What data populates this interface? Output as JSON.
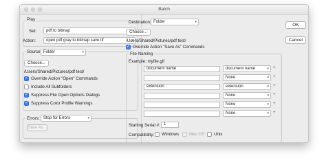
{
  "window": {
    "title": "Batch"
  },
  "play": {
    "group_label": "Play",
    "set_label": "Set:",
    "set_value": "pdf to bitmap",
    "action_label": "Action:",
    "action_value": "open pdf gray to bitmap save tif"
  },
  "source": {
    "label": "Source:",
    "value": "Folder",
    "choose_label": "Choose...",
    "path": "/Users/Shared/Pictures/pdf test/",
    "checks": [
      {
        "label": "Override Action \"Open\" Commands",
        "checked": true
      },
      {
        "label": "Include All Subfolders",
        "checked": false
      },
      {
        "label": "Suppress File Open Options Dialogs",
        "checked": true
      },
      {
        "label": "Suppress Color Profile Warnings",
        "checked": true
      }
    ]
  },
  "errors": {
    "label": "Errors:",
    "value": "Stop for Errors",
    "save_as_label": "Save As..."
  },
  "destination": {
    "label": "Destination:",
    "value": "Folder",
    "choose_label": "Choose...",
    "path": "/Users/Shared/Pictures/pdf test/",
    "override_label": "Override Action \"Save As\" Commands",
    "override_checked": true
  },
  "file_naming": {
    "group_label": "File Naming",
    "example": "Example: myfile.gif",
    "rows": [
      {
        "field": "document name",
        "select": "document name"
      },
      {
        "field": "",
        "select": "None"
      },
      {
        "field": "extension",
        "select": "extension"
      },
      {
        "field": "",
        "select": "None"
      },
      {
        "field": "",
        "select": "None"
      },
      {
        "field": "",
        "select": "None"
      }
    ],
    "plus_glyph": "+",
    "serial_label": "Starting Serial #:",
    "serial_value": "1",
    "compat_label": "Compatibility:",
    "compat": [
      {
        "label": "Windows",
        "checked": false,
        "disabled": false
      },
      {
        "label": "Mac OS",
        "checked": true,
        "disabled": true
      },
      {
        "label": "Unix",
        "checked": false,
        "disabled": false
      }
    ]
  },
  "buttons": {
    "ok": "OK",
    "cancel": "Cancel"
  },
  "icons": {
    "select_arrow": "chevron-updown-icon",
    "check": "checkmark-icon"
  },
  "colors": {
    "accent": "#3b82f6",
    "panel": "#ececec"
  }
}
